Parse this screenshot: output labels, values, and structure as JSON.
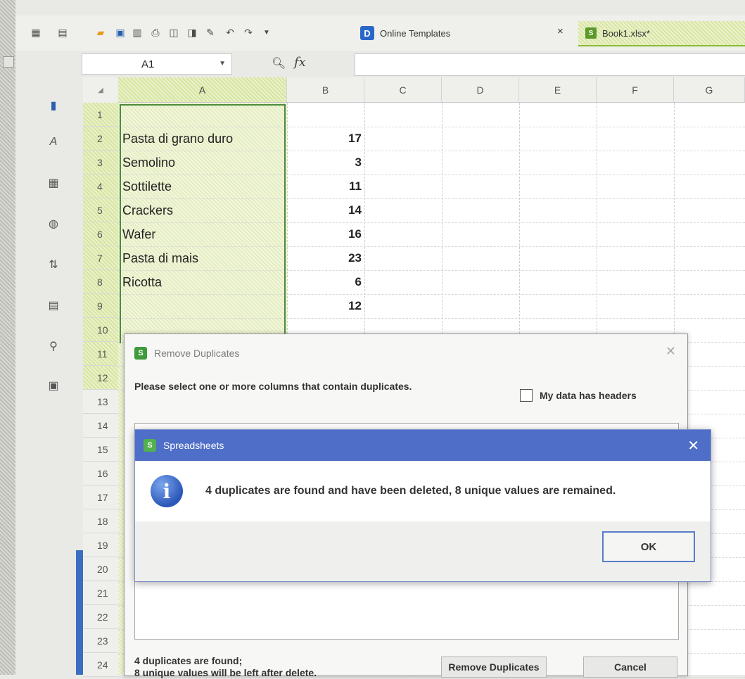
{
  "toolbar": {
    "online_templates_tab": "Online Templates",
    "close_symbol": "×",
    "workbook_tab": "Book1.xlsx*"
  },
  "formula_bar": {
    "name_box": "A1",
    "fx_label": "fx",
    "formula_value": ""
  },
  "sheet": {
    "columns": [
      "A",
      "B",
      "C",
      "D",
      "E",
      "F",
      "G"
    ],
    "selected_column": "A",
    "rows": [
      {
        "n": "1",
        "a": "",
        "b": ""
      },
      {
        "n": "2",
        "a": "Pasta di grano duro",
        "b": "17"
      },
      {
        "n": "3",
        "a": "Semolino",
        "b": "3"
      },
      {
        "n": "4",
        "a": "Sottilette",
        "b": "11"
      },
      {
        "n": "5",
        "a": "Crackers",
        "b": "14"
      },
      {
        "n": "6",
        "a": "Wafer",
        "b": "16"
      },
      {
        "n": "7",
        "a": "Pasta di mais",
        "b": "23"
      },
      {
        "n": "8",
        "a": "Ricotta",
        "b": "6"
      },
      {
        "n": "9",
        "a": "",
        "b": "12"
      },
      {
        "n": "10",
        "a": "",
        "b": ""
      },
      {
        "n": "11",
        "a": "",
        "b": ""
      },
      {
        "n": "12",
        "a": "",
        "b": ""
      },
      {
        "n": "13",
        "a": "",
        "b": ""
      },
      {
        "n": "14",
        "a": "",
        "b": ""
      },
      {
        "n": "15",
        "a": "",
        "b": ""
      },
      {
        "n": "16",
        "a": "",
        "b": ""
      },
      {
        "n": "17",
        "a": "",
        "b": ""
      },
      {
        "n": "18",
        "a": "",
        "b": ""
      },
      {
        "n": "19",
        "a": "",
        "b": ""
      },
      {
        "n": "20",
        "a": "",
        "b": ""
      },
      {
        "n": "21",
        "a": "",
        "b": ""
      },
      {
        "n": "22",
        "a": "",
        "b": ""
      },
      {
        "n": "23",
        "a": "",
        "b": ""
      },
      {
        "n": "24",
        "a": "",
        "b": ""
      }
    ]
  },
  "remove_duplicates_dialog": {
    "title": "Remove Duplicates",
    "prompt": "Please select one or more columns that contain duplicates.",
    "headers_checkbox_label": "My data has headers",
    "headers_checked": false,
    "status_line1": "4 duplicates are found;",
    "status_line2": "8 unique values will be left after delete.",
    "remove_button": "Remove Duplicates",
    "cancel_button": "Cancel"
  },
  "message_box": {
    "title": "Spreadsheets",
    "icon": "info-icon",
    "message": "4 duplicates are found and have been deleted, 8 unique values are remained.",
    "ok_button": "OK"
  },
  "colors": {
    "selection_green": "#4b8b3b",
    "message_title_blue": "#4f6ec7",
    "app_green": "#3e9a3a"
  }
}
